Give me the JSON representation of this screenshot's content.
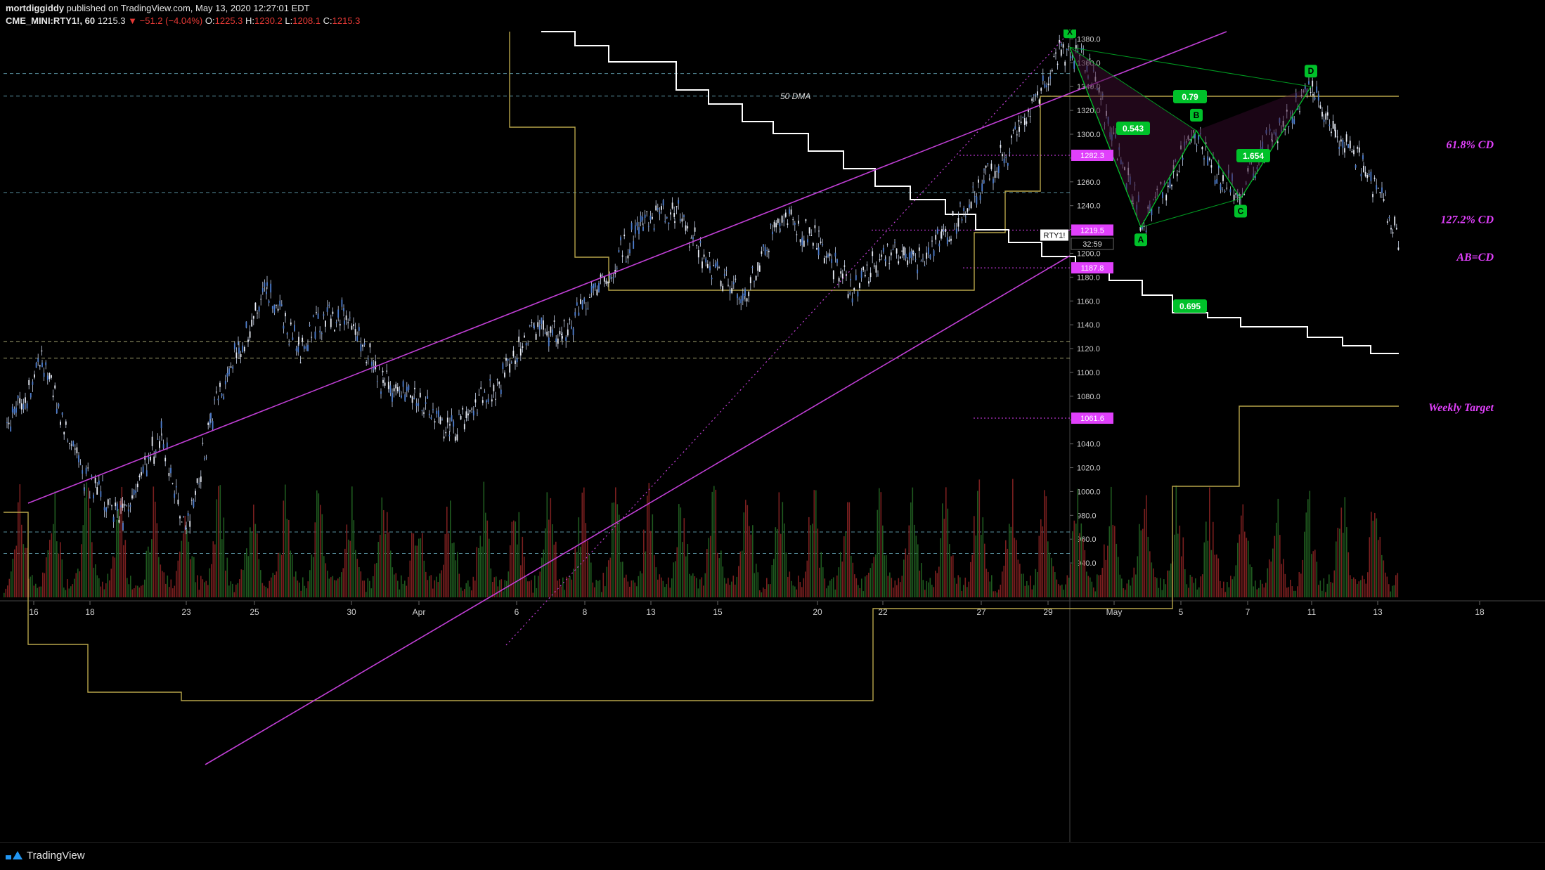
{
  "header": {
    "author": "mortdiggiddy",
    "published": "published on TradingView.com, May 13, 2020 12:27:01 EDT",
    "symbol": "CME_MINI:RTY1!, 60",
    "price": "1215.3",
    "change": "▼ −51.2 (−4.04%)",
    "open_label": "O:",
    "open": "1225.3",
    "high_label": "H:",
    "high": "1230.2",
    "low_label": "L:",
    "low": "1208.1",
    "close_label": "C:",
    "close": "1215.3"
  },
  "footer": {
    "brand": "TradingView"
  },
  "colors": {
    "background": "#000000",
    "channel": "#c13fd6",
    "annotation": "#e040fb",
    "pattern_green": "#00c12a",
    "step_yellow": "#b8a64a",
    "dma_white": "#ffffff",
    "hline_cyan": "#6fb6c8",
    "hline_yellow": "#c9c98a",
    "candle": "#c7d3ea",
    "volume_red": "#7a1f1f",
    "volume_green": "#1f5a1f"
  },
  "chart_data": {
    "type": "candlestick",
    "symbol": "CME_MINI:RTY1!",
    "timeframe": "60",
    "ylim": [
      920,
      1395
    ],
    "y_ticks": [
      "1380.0",
      "1360.0",
      "1340.0",
      "1320.0",
      "1300.0",
      "1280.0",
      "1260.0",
      "1240.0",
      "1220.0",
      "1200.0",
      "1180.0",
      "1160.0",
      "1140.0",
      "1120.0",
      "1100.0",
      "1080.0",
      "1060.0",
      "1040.0",
      "1020.0",
      "1000.0",
      "980.0",
      "960.0",
      "940.0"
    ],
    "x_ticks": [
      "16",
      "18",
      "23",
      "25",
      "30",
      "Apr",
      "6",
      "8",
      "13",
      "15",
      "20",
      "22",
      "27",
      "29",
      "May",
      "5",
      "7",
      "11",
      "13",
      "18"
    ],
    "trend": [
      {
        "x": "16",
        "y": 1050
      },
      {
        "x": "17",
        "y": 1110
      },
      {
        "x": "18",
        "y": 1010
      },
      {
        "x": "19",
        "y": 980
      },
      {
        "x": "20",
        "y": 1050
      },
      {
        "x": "23",
        "y": 965
      },
      {
        "x": "24",
        "y": 1060
      },
      {
        "x": "25",
        "y": 1120
      },
      {
        "x": "26",
        "y": 1170
      },
      {
        "x": "27",
        "y": 1120
      },
      {
        "x": "30",
        "y": 1140
      },
      {
        "x": "31",
        "y": 1150
      },
      {
        "x": "Apr",
        "y": 1090
      },
      {
        "x": "2",
        "y": 1080
      },
      {
        "x": "3",
        "y": 1050
      },
      {
        "x": "6",
        "y": 1100
      },
      {
        "x": "7",
        "y": 1140
      },
      {
        "x": "8",
        "y": 1130
      },
      {
        "x": "9",
        "y": 1190
      },
      {
        "x": "13",
        "y": 1225
      },
      {
        "x": "14",
        "y": 1235
      },
      {
        "x": "15",
        "y": 1190
      },
      {
        "x": "16",
        "y": 1160
      },
      {
        "x": "17",
        "y": 1230
      },
      {
        "x": "20",
        "y": 1210
      },
      {
        "x": "21",
        "y": 1170
      },
      {
        "x": "22",
        "y": 1200
      },
      {
        "x": "23",
        "y": 1195
      },
      {
        "x": "24",
        "y": 1210
      },
      {
        "x": "27",
        "y": 1260
      },
      {
        "x": "28",
        "y": 1300
      },
      {
        "x": "29",
        "y": 1370
      },
      {
        "x": "30",
        "y": 1360
      },
      {
        "x": "May",
        "y": 1250
      },
      {
        "x": "4",
        "y": 1225
      },
      {
        "x": "5",
        "y": 1300
      },
      {
        "x": "6",
        "y": 1260
      },
      {
        "x": "7",
        "y": 1250
      },
      {
        "x": "8",
        "y": 1300
      },
      {
        "x": "11",
        "y": 1338
      },
      {
        "x": "12",
        "y": 1300
      },
      {
        "x": "12b",
        "y": 1275
      },
      {
        "x": "13",
        "y": 1215
      }
    ],
    "price_labels": [
      {
        "label": "1282.3",
        "y": 1282.3
      },
      {
        "label": "1219.5",
        "y": 1219.5
      },
      {
        "label": "RTY1!",
        "y": 1215.3
      },
      {
        "label": "32:59",
        "y": 1208.0
      },
      {
        "label": "1187.8",
        "y": 1187.8
      },
      {
        "label": "1061.6",
        "y": 1061.6
      }
    ],
    "annotations": [
      {
        "text": "61.8% CD",
        "y": 1282.3
      },
      {
        "text": "127.2% CD",
        "y": 1219.5
      },
      {
        "text": "AB=CD",
        "y": 1187.8
      },
      {
        "text": "Weekly Target",
        "y": 1061.6
      },
      {
        "text": "50 DMA",
        "y": 1360
      }
    ],
    "harmonic_pattern": {
      "points": [
        {
          "label": "X",
          "y": 1373
        },
        {
          "label": "A",
          "y": 1222
        },
        {
          "label": "B",
          "y": 1303
        },
        {
          "label": "C",
          "y": 1246
        },
        {
          "label": "D",
          "y": 1340
        }
      ],
      "ratios": [
        "0.543",
        "0.695",
        "1.654",
        "0.79"
      ]
    },
    "horizontal_levels": [
      1351,
      1332,
      1251,
      1126,
      1112,
      966,
      948
    ]
  }
}
